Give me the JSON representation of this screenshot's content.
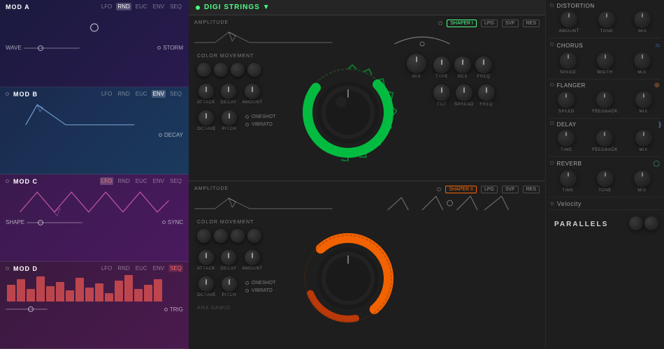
{
  "leftPanel": {
    "modA": {
      "title": "MOD A",
      "tabs": [
        "LFO",
        "RND",
        "EUC",
        "ENV",
        "SEQ"
      ],
      "activeTab": "RND",
      "waveLabel": "WAVE",
      "rightLabel": "STORM"
    },
    "modB": {
      "title": "MOD B",
      "tabs": [
        "LFO",
        "RND",
        "EUC",
        "ENV",
        "SEQ"
      ],
      "activeTab": "ENV",
      "rightLabel": "DECAY"
    },
    "modC": {
      "title": "MOD C",
      "tabs": [
        "LFO",
        "RND",
        "EUC",
        "ENV",
        "SEQ"
      ],
      "activeTab": "LFO",
      "shapeLabel": "SHAPE",
      "rightLabel": "SYNC"
    },
    "modD": {
      "title": "MOD D",
      "tabs": [
        "LFO",
        "RND",
        "EUC",
        "ENV",
        "SEQ"
      ],
      "activeTab": "SEQ",
      "rightLabel": "TRIG"
    }
  },
  "middlePanel": {
    "synthName": "DIGI STRINGS",
    "osc1": {
      "sectionLabel": "AMPLITUDE",
      "colorMovement": "COLOR MOVEMENT",
      "attackLabel": "ATTACK",
      "decayLabel": "DECAY",
      "amountLabel": "AMOUNT",
      "octaveLabel": "OCTAVE",
      "pitchLabel": "PITCH",
      "oneShotLabel": "ONESHOT",
      "vibratoLabel": "VIBRATO",
      "mixLabel": "MIX",
      "typeLabel": "TYPE",
      "resLabel": "RES",
      "freqLabel": "FREQ",
      "shaperLabel": "SHAPER I",
      "lpgLabel": "LPG",
      "svfLabel": "SVF",
      "resLabel2": "RES",
      "tiltLabel": "TILT",
      "spreadLabel": "SPREAD",
      "freqLabel2": "FREQ"
    },
    "osc2": {
      "sectionLabel": "AMPLITUDE",
      "colorMovement": "COLOR MOVEMENT",
      "attackLabel": "ATTACK",
      "decayLabel": "DECAY",
      "amountLabel": "AMOUNT",
      "octaveLabel": "OCTAVE",
      "pitchLabel": "PITCH",
      "oneShotLabel": "ONESHOT",
      "vibratoLabel": "VIBRATO",
      "shaperLabel": "SHAPER II",
      "lpgLabel": "LPG",
      "svfLabel": "SVF",
      "resLabel": "RES",
      "bottomLabel": "ANA DAWID"
    }
  },
  "rightPanel": {
    "distortion": {
      "name": "DISTORTION",
      "knobs": [
        "AMOUNT",
        "TONE",
        "MIX"
      ],
      "icon": "⚡"
    },
    "chorus": {
      "name": "CHORUS",
      "knobs": [
        "SPEED",
        "WIDTH",
        "MIX"
      ],
      "icon": "≈"
    },
    "flanger": {
      "name": "FLANGER",
      "knobs": [
        "SPEED",
        "FEEDBACK",
        "MIX"
      ],
      "icon": "🌀"
    },
    "delay": {
      "name": "DELAY",
      "knobs": [
        "TIME",
        "FEEDBACK",
        "MIX"
      ],
      "icon": "))"
    },
    "reverb": {
      "name": "REVERB",
      "knobs": [
        "TIME",
        "TONE",
        "MIX"
      ],
      "icon": "⬡"
    },
    "velocity": {
      "name": "Velocity"
    },
    "parallels": {
      "name": "PARALLELS"
    }
  },
  "colors": {
    "green": "#4dff88",
    "orange": "#ff6600",
    "purple": "#8844aa",
    "teal": "#2288aa",
    "pink": "#cc3388",
    "accent": "#4dff88"
  }
}
